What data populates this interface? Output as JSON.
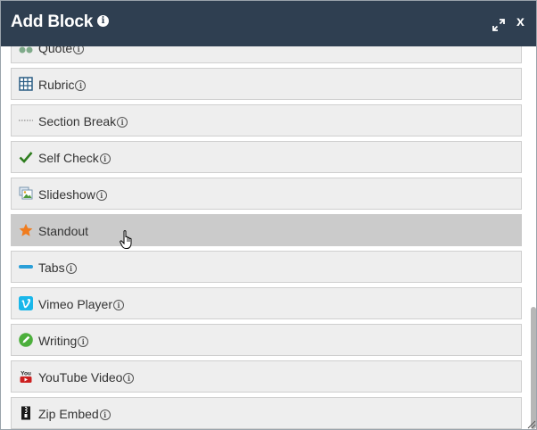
{
  "dialog": {
    "title": "Add Block",
    "info_glyph": "i",
    "close_label": "x"
  },
  "blocks": [
    {
      "label": "Quote",
      "icon": "quote-icon",
      "info": "i"
    },
    {
      "label": "Rubric",
      "icon": "table-grid-icon",
      "info": "i"
    },
    {
      "label": "Section Break",
      "icon": "dotted-line-icon",
      "info": "i"
    },
    {
      "label": "Self Check",
      "icon": "checkmark-icon",
      "info": "i"
    },
    {
      "label": "Slideshow",
      "icon": "slideshow-icon",
      "info": "i"
    },
    {
      "label": "Standout",
      "icon": "star-icon"
    },
    {
      "label": "Tabs",
      "icon": "tabs-bar-icon",
      "info": "i"
    },
    {
      "label": "Vimeo Player",
      "icon": "vimeo-icon",
      "info": "i"
    },
    {
      "label": "Writing",
      "icon": "pencil-circle-icon",
      "info": "i"
    },
    {
      "label": "YouTube Video",
      "icon": "youtube-icon",
      "info": "i",
      "icon_text": "You"
    },
    {
      "label": "Zip Embed",
      "icon": "zip-file-icon",
      "info": "i"
    }
  ],
  "colors": {
    "titlebar": "#2f3f51",
    "item_bg": "#eeeeee",
    "item_hover_bg": "#cbcbcb",
    "check_green": "#2e7d1e",
    "star_orange": "#f07c1e",
    "tabs_blue": "#2a9fd8",
    "vimeo_teal": "#1ab7ea",
    "writing_green": "#4caf3c",
    "youtube_red": "#cc2020"
  }
}
